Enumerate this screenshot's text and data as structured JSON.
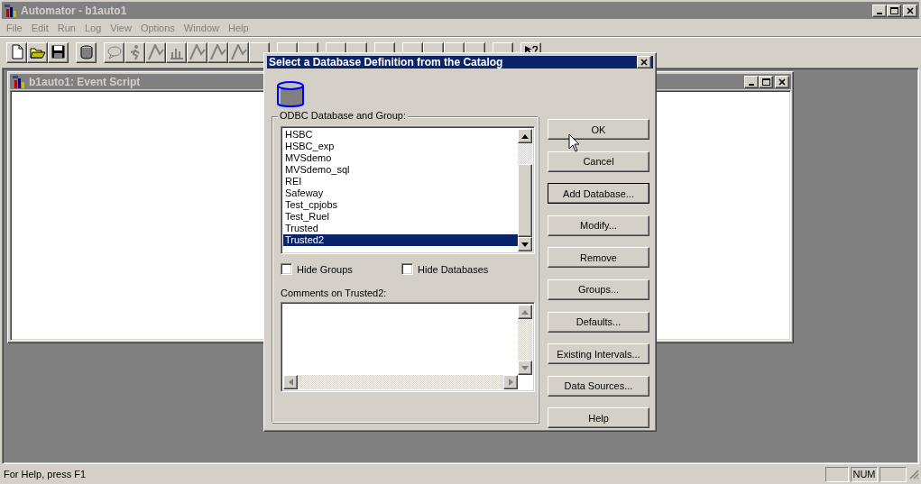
{
  "app": {
    "title": "Automator - b1auto1",
    "menu": [
      "File",
      "Edit",
      "Run",
      "Log",
      "View",
      "Options",
      "Window",
      "Help"
    ],
    "toolbar": [
      {
        "kind": "new",
        "disabled": false
      },
      {
        "kind": "open",
        "disabled": false
      },
      {
        "kind": "save",
        "disabled": false
      },
      {
        "kind": "separator"
      },
      {
        "kind": "database",
        "disabled": false
      },
      {
        "kind": "separator"
      },
      {
        "kind": "chat",
        "disabled": true
      },
      {
        "kind": "runner",
        "disabled": true
      },
      {
        "kind": "generic",
        "disabled": true
      },
      {
        "kind": "chart",
        "disabled": true
      },
      {
        "kind": "generic",
        "disabled": true
      },
      {
        "kind": "generic",
        "disabled": true
      },
      {
        "kind": "generic",
        "disabled": true
      },
      {
        "kind": "covered"
      },
      {
        "kind": "separator"
      },
      {
        "kind": "covered"
      },
      {
        "kind": "covered"
      },
      {
        "kind": "separator"
      },
      {
        "kind": "covered"
      },
      {
        "kind": "covered"
      },
      {
        "kind": "separator"
      },
      {
        "kind": "covered"
      },
      {
        "kind": "separator"
      },
      {
        "kind": "covered"
      },
      {
        "kind": "covered"
      },
      {
        "kind": "covered"
      },
      {
        "kind": "covered"
      },
      {
        "kind": "separator"
      },
      {
        "kind": "covered"
      },
      {
        "kind": "separator"
      },
      {
        "kind": "help",
        "disabled": false
      }
    ]
  },
  "child_window": {
    "title": "b1auto1: Event Script"
  },
  "dialog": {
    "title": "Select a Database Definition from the Catalog",
    "group_label": "ODBC Database and Group:",
    "items": [
      {
        "label": "HSBC",
        "selected": false
      },
      {
        "label": "HSBC_exp",
        "selected": false
      },
      {
        "label": "MVSdemo",
        "selected": false
      },
      {
        "label": "MVSdemo_sql",
        "selected": false
      },
      {
        "label": "REI",
        "selected": false
      },
      {
        "label": "Safeway",
        "selected": false
      },
      {
        "label": "Test_cpjobs",
        "selected": false
      },
      {
        "label": "Test_Ruel",
        "selected": false
      },
      {
        "label": "Trusted",
        "selected": false
      },
      {
        "label": "Trusted2",
        "selected": true
      }
    ],
    "checkboxes": [
      {
        "label": "Hide Groups",
        "checked": false
      },
      {
        "label": "Hide Databases",
        "checked": false
      }
    ],
    "comments_label": "Comments on Trusted2:",
    "buttons": [
      {
        "label": "OK",
        "default": false
      },
      {
        "label": "Cancel",
        "default": false
      },
      {
        "label": "Add Database...",
        "default": true
      },
      {
        "label": "Modify...",
        "default": false
      },
      {
        "label": "Remove",
        "default": false
      },
      {
        "label": "Groups...",
        "default": false
      },
      {
        "label": "Defaults...",
        "default": false
      },
      {
        "label": "Existing Intervals...",
        "default": false
      },
      {
        "label": "Data Sources...",
        "default": false
      },
      {
        "label": "Help",
        "default": false
      }
    ]
  },
  "status_bar": {
    "text": "For Help, press F1",
    "indicator": "NUM"
  }
}
